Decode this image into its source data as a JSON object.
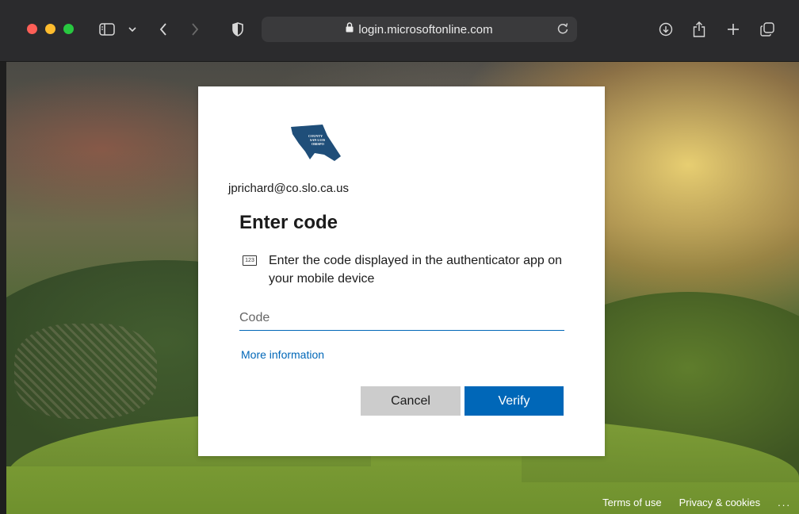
{
  "browser": {
    "url": "login.microsoftonline.com",
    "icons": [
      "sidebar-icon",
      "chevron-down-icon",
      "back-icon",
      "forward-icon",
      "shield-icon",
      "lock-icon",
      "reload-icon",
      "download-icon",
      "share-icon",
      "plus-icon",
      "tabs-icon"
    ]
  },
  "card": {
    "logo_text": [
      "COUNTY",
      "SAN LUIS",
      "OBISPO"
    ],
    "account": "jprichard@co.slo.ca.us",
    "title": "Enter code",
    "instruction_icon": "123",
    "instruction": "Enter the code displayed in the authenticator app on your mobile device",
    "code_placeholder": "Code",
    "code_value": "",
    "more_info": "More information",
    "cancel_label": "Cancel",
    "verify_label": "Verify"
  },
  "footer": {
    "terms": "Terms of use",
    "privacy": "Privacy & cookies",
    "more": "..."
  },
  "colors": {
    "accent": "#0067b8",
    "cancel_bg": "#cccccc",
    "logo": "#1f4e79"
  }
}
